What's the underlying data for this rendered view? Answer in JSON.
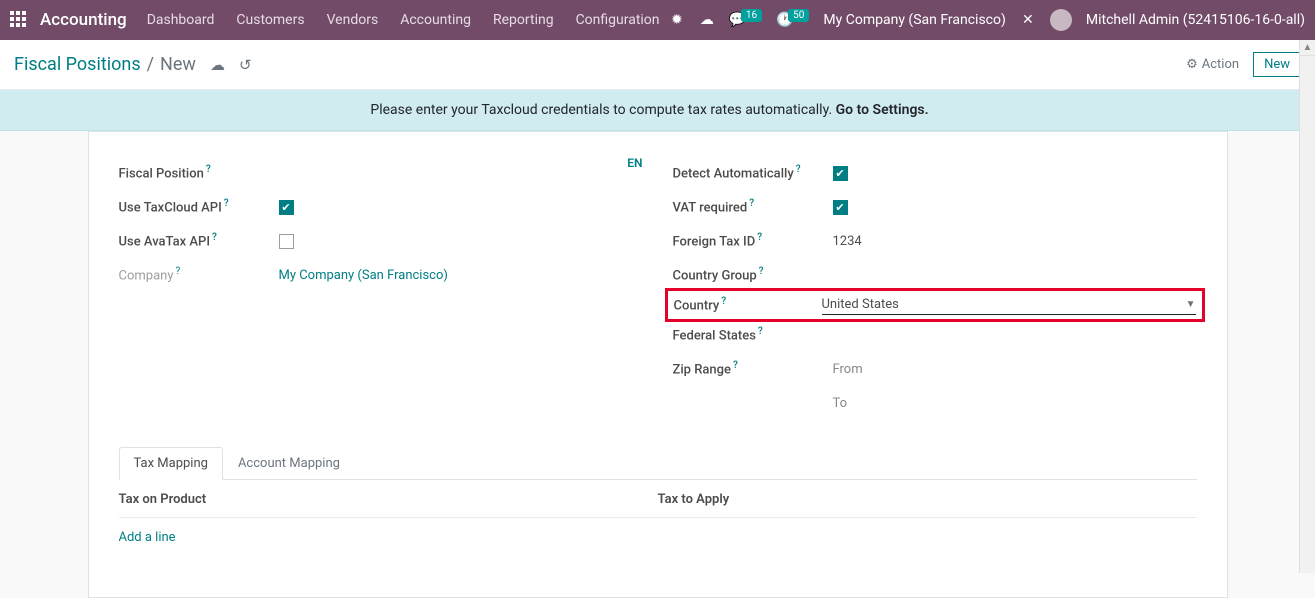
{
  "topbar": {
    "brand": "Accounting",
    "nav": [
      "Dashboard",
      "Customers",
      "Vendors",
      "Accounting",
      "Reporting",
      "Configuration"
    ],
    "messages_badge": "16",
    "activities_badge": "50",
    "company": "My Company (San Francisco)",
    "user": "Mitchell Admin (52415106-16-0-all)"
  },
  "ctrlbar": {
    "bc1": "Fiscal Positions",
    "bc2": "New",
    "action": "Action",
    "newbtn": "New"
  },
  "alert": {
    "text": "Please enter your Taxcloud credentials to compute tax rates automatically. ",
    "link": "Go to Settings."
  },
  "form": {
    "lang": "EN",
    "left": {
      "fiscal_position": "Fiscal Position",
      "use_taxcloud": "Use TaxCloud API",
      "use_avatax": "Use AvaTax API",
      "company_label": "Company",
      "company_value": "My Company (San Francisco)"
    },
    "right": {
      "detect": "Detect Automatically",
      "vat_required": "VAT required",
      "foreign_tax_label": "Foreign Tax ID",
      "foreign_tax_value": "1234",
      "country_group": "Country Group",
      "country_label": "Country",
      "country_value": "United States",
      "federal_states": "Federal States",
      "zip_range": "Zip Range",
      "zip_from": "From",
      "zip_to": "To"
    }
  },
  "tabs": {
    "tax_mapping": "Tax Mapping",
    "account_mapping": "Account Mapping"
  },
  "table": {
    "h1": "Tax on Product",
    "h2": "Tax to Apply",
    "addline": "Add a line"
  }
}
